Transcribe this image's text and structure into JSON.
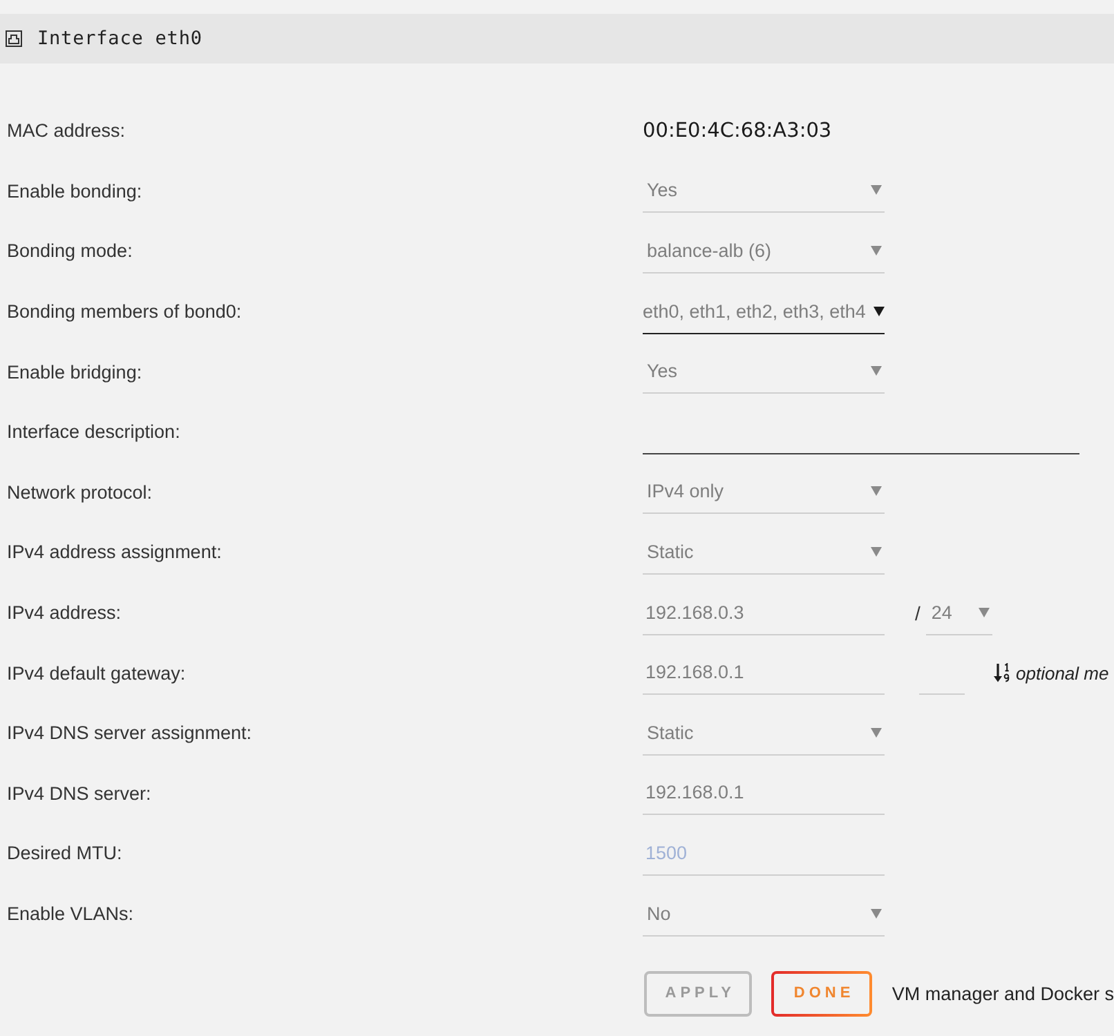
{
  "header": {
    "title": "Interface eth0"
  },
  "settings": [
    {
      "label": "MAC address:",
      "kind": "text",
      "value": "00:E0:4C:68:A3:03"
    },
    {
      "label": "Enable bonding:",
      "kind": "select",
      "value": "Yes"
    },
    {
      "label": "Bonding mode:",
      "kind": "select",
      "value": "balance-alb (6)"
    },
    {
      "label": "Bonding members of bond0:",
      "kind": "multi-select",
      "value": "eth0, eth1, eth2, eth3, eth4"
    },
    {
      "label": "Enable bridging:",
      "kind": "select",
      "value": "Yes"
    },
    {
      "label": "Interface description:",
      "kind": "wide-input"
    },
    {
      "label": "Network protocol:",
      "kind": "select",
      "value": "IPv4 only"
    },
    {
      "label": "IPv4 address assignment:",
      "kind": "select",
      "value": "Static"
    },
    {
      "label": "IPv4 address:",
      "kind": "address",
      "value": "192.168.0.3",
      "separator": "/",
      "netmask": "24"
    },
    {
      "label": "IPv4 default gateway:",
      "kind": "gateway",
      "value": "192.168.0.1",
      "note": "optional me"
    },
    {
      "label": "IPv4 DNS server assignment:",
      "kind": "select",
      "value": "Static"
    },
    {
      "label": "IPv4 DNS server:",
      "kind": "input",
      "value": "192.168.0.1"
    },
    {
      "label": "Desired MTU:",
      "kind": "input",
      "placeholder": "1500"
    },
    {
      "label": "Enable VLANs:",
      "kind": "select",
      "value": "No"
    }
  ],
  "buttons": [
    {
      "label": "APPLY",
      "disabled": true
    },
    {
      "label": "DONE",
      "disabled": false
    }
  ],
  "note": "VM manager and Docker s"
}
